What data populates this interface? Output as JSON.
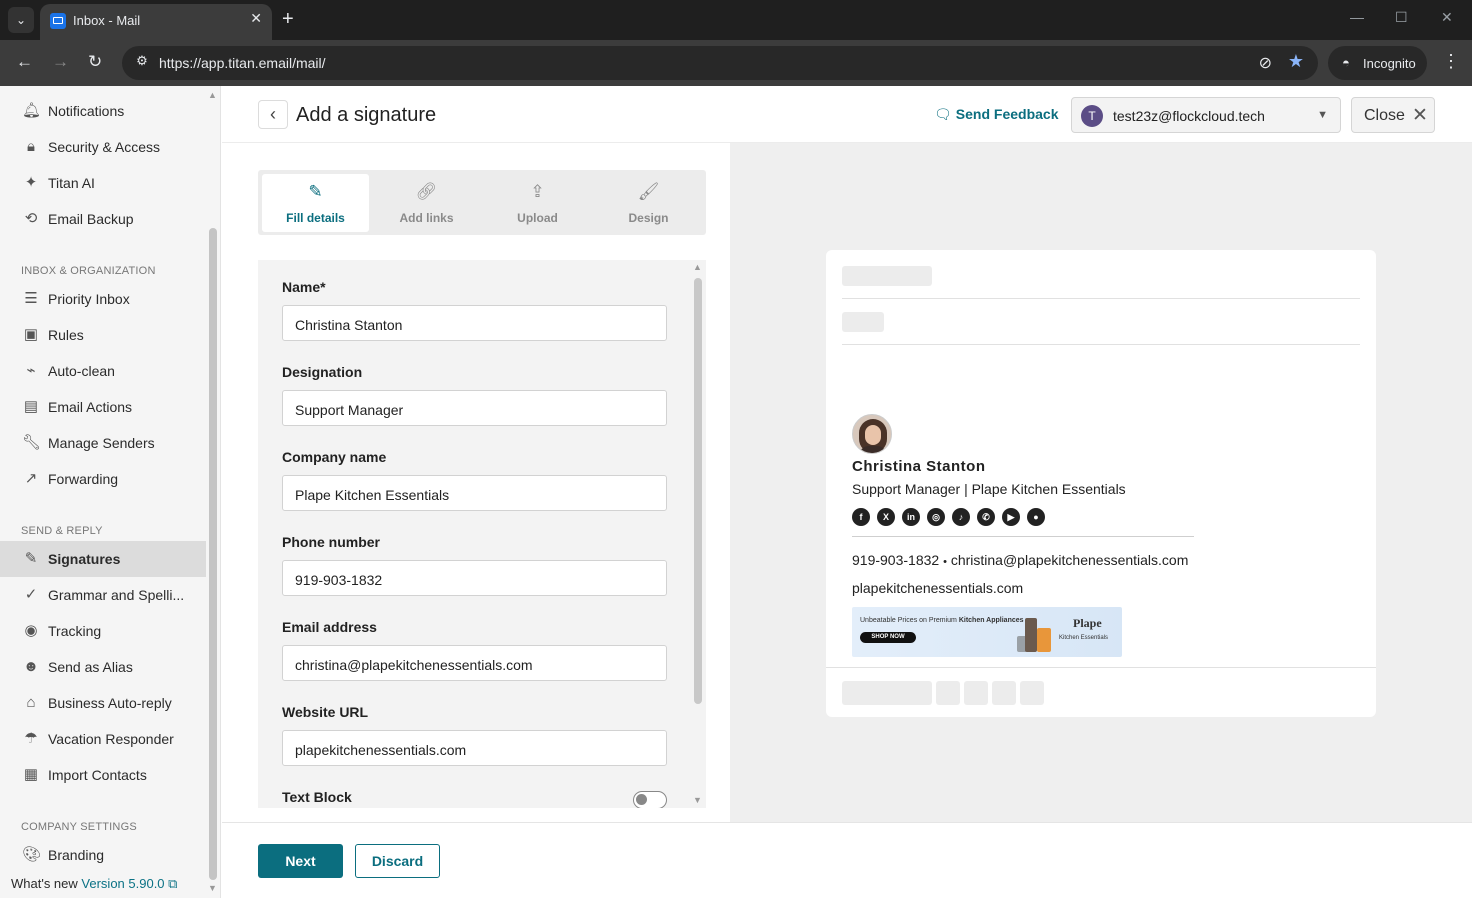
{
  "browser": {
    "tab_title": "Inbox - Mail",
    "url": "https://app.titan.email/mail/",
    "incognito_label": "Incognito"
  },
  "sidebar": {
    "top_items": [
      {
        "label": "Notifications",
        "icon": "bell-icon"
      },
      {
        "label": "Security & Access",
        "icon": "lock-icon"
      },
      {
        "label": "Titan AI",
        "icon": "ai-sparkle-icon"
      },
      {
        "label": "Email Backup",
        "icon": "backup-icon"
      }
    ],
    "section_inbox": "INBOX & ORGANIZATION",
    "inbox_items": [
      {
        "label": "Priority Inbox",
        "icon": "priority-icon"
      },
      {
        "label": "Rules",
        "icon": "rules-icon"
      },
      {
        "label": "Auto-clean",
        "icon": "broom-icon"
      },
      {
        "label": "Email Actions",
        "icon": "email-actions-icon"
      },
      {
        "label": "Manage Senders",
        "icon": "wrench-icon"
      },
      {
        "label": "Forwarding",
        "icon": "forward-icon"
      }
    ],
    "section_send": "SEND & REPLY",
    "send_items": [
      {
        "label": "Signatures",
        "icon": "pen-icon"
      },
      {
        "label": "Grammar and Spelli...",
        "icon": "grammar-icon"
      },
      {
        "label": "Tracking",
        "icon": "eye-icon"
      },
      {
        "label": "Send as Alias",
        "icon": "alias-icon"
      },
      {
        "label": "Business Auto-reply",
        "icon": "auto-reply-icon"
      },
      {
        "label": "Vacation Responder",
        "icon": "umbrella-icon"
      },
      {
        "label": "Import Contacts",
        "icon": "contacts-icon"
      }
    ],
    "section_company": "COMPANY SETTINGS",
    "company_items": [
      {
        "label": "Branding",
        "icon": "palette-icon"
      }
    ],
    "whats_new": "What's new",
    "version": "Version 5.90.0"
  },
  "header": {
    "title": "Add a signature",
    "feedback": "Send Feedback",
    "account_initial": "T",
    "account_email": "test23z@flockcloud.tech",
    "close": "Close"
  },
  "steps": [
    {
      "label": "Fill details",
      "icon": "pencil-icon"
    },
    {
      "label": "Add links",
      "icon": "link-icon"
    },
    {
      "label": "Upload",
      "icon": "upload-icon"
    },
    {
      "label": "Design",
      "icon": "brush-icon"
    }
  ],
  "form": {
    "name_label": "Name*",
    "name_value": "Christina Stanton",
    "designation_label": "Designation",
    "designation_value": "Support Manager",
    "company_label": "Company name",
    "company_value": "Plape Kitchen Essentials",
    "phone_label": "Phone number",
    "phone_value": "919-903-1832",
    "email_label": "Email address",
    "email_value": "christina@plapekitchenessentials.com",
    "website_label": "Website URL",
    "website_value": "plapekitchenessentials.com",
    "textblock_label": "Text Block"
  },
  "preview": {
    "name": "Christina Stanton",
    "title_line": "Support Manager | Plape Kitchen Essentials",
    "socials": [
      "facebook-icon",
      "x-icon",
      "linkedin-icon",
      "instagram-icon",
      "tiktok-icon",
      "whatsapp-icon",
      "youtube-icon",
      "location-icon"
    ],
    "phone": "919-903-1832",
    "separator": "•",
    "email": "christina@plapekitchenessentials.com",
    "website": "plapekitchenessentials.com",
    "banner_text_prefix": "Unbeatable Prices on Premium ",
    "banner_text_bold": "Kitchen Appliances",
    "banner_button": "SHOP NOW",
    "banner_brand": "Plape",
    "banner_sub": "Kitchen Essentials"
  },
  "footer": {
    "next": "Next",
    "discard": "Discard"
  }
}
